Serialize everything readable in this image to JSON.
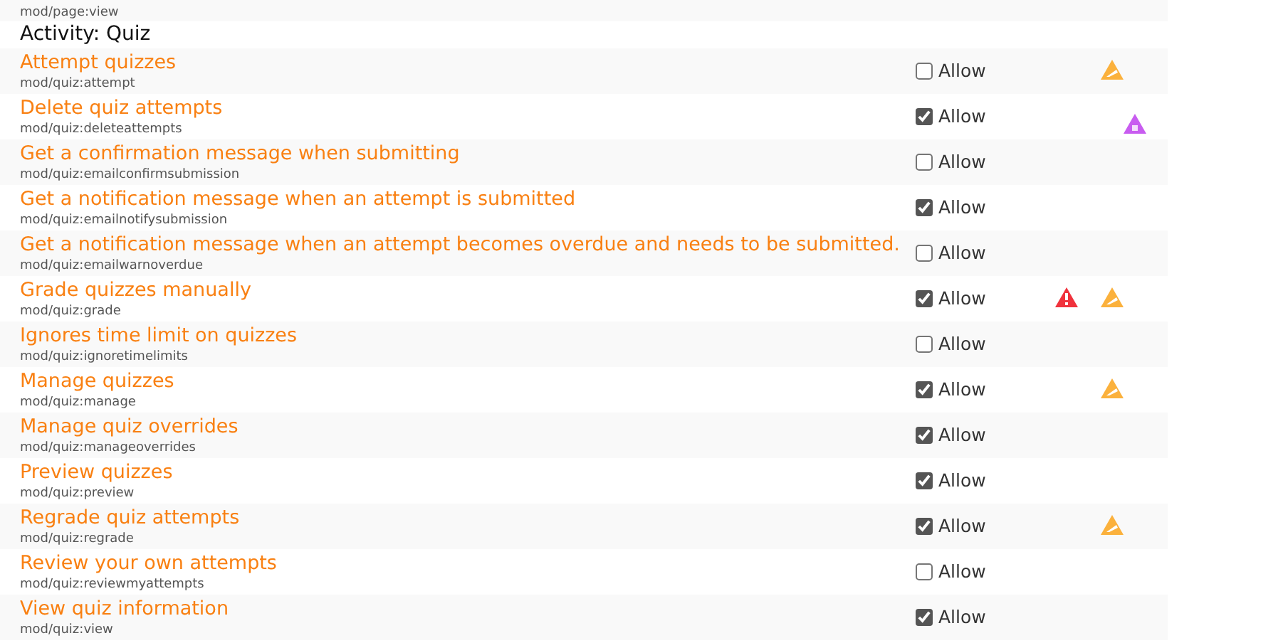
{
  "previous_row": {
    "capability": "mod/page:view"
  },
  "section": {
    "title": "Activity: Quiz"
  },
  "rows": [
    {
      "name": "Attempt quizzes",
      "capability": "mod/quiz:attempt",
      "checked": false,
      "permission": "Allow",
      "risks": [
        {
          "kind": "config"
        }
      ]
    },
    {
      "name": "Delete quiz attempts",
      "capability": "mod/quiz:deleteattempts",
      "checked": true,
      "permission": "Allow",
      "risks": [
        {
          "kind": "dataloss"
        }
      ]
    },
    {
      "name": "Get a confirmation message when submitting",
      "capability": "mod/quiz:emailconfirmsubmission",
      "checked": false,
      "permission": "Allow",
      "risks": []
    },
    {
      "name": "Get a notification message when an attempt is submitted",
      "capability": "mod/quiz:emailnotifysubmission",
      "checked": true,
      "permission": "Allow",
      "risks": []
    },
    {
      "name": "Get a notification message when an attempt becomes overdue and needs to be submitted.",
      "capability": "mod/quiz:emailwarnoverdue",
      "checked": false,
      "permission": "Allow",
      "risks": []
    },
    {
      "name": "Grade quizzes manually",
      "capability": "mod/quiz:grade",
      "checked": true,
      "permission": "Allow",
      "risks": [
        {
          "kind": "xss"
        },
        {
          "kind": "config"
        }
      ]
    },
    {
      "name": "Ignores time limit on quizzes",
      "capability": "mod/quiz:ignoretimelimits",
      "checked": false,
      "permission": "Allow",
      "risks": []
    },
    {
      "name": "Manage quizzes",
      "capability": "mod/quiz:manage",
      "checked": true,
      "permission": "Allow",
      "risks": [
        {
          "kind": "config"
        }
      ]
    },
    {
      "name": "Manage quiz overrides",
      "capability": "mod/quiz:manageoverrides",
      "checked": true,
      "permission": "Allow",
      "risks": []
    },
    {
      "name": "Preview quizzes",
      "capability": "mod/quiz:preview",
      "checked": true,
      "permission": "Allow",
      "risks": []
    },
    {
      "name": "Regrade quiz attempts",
      "capability": "mod/quiz:regrade",
      "checked": true,
      "permission": "Allow",
      "risks": [
        {
          "kind": "config"
        }
      ]
    },
    {
      "name": "Review your own attempts",
      "capability": "mod/quiz:reviewmyattempts",
      "checked": false,
      "permission": "Allow",
      "risks": []
    },
    {
      "name": "View quiz information",
      "capability": "mod/quiz:view",
      "checked": true,
      "permission": "Allow",
      "risks": []
    }
  ]
}
